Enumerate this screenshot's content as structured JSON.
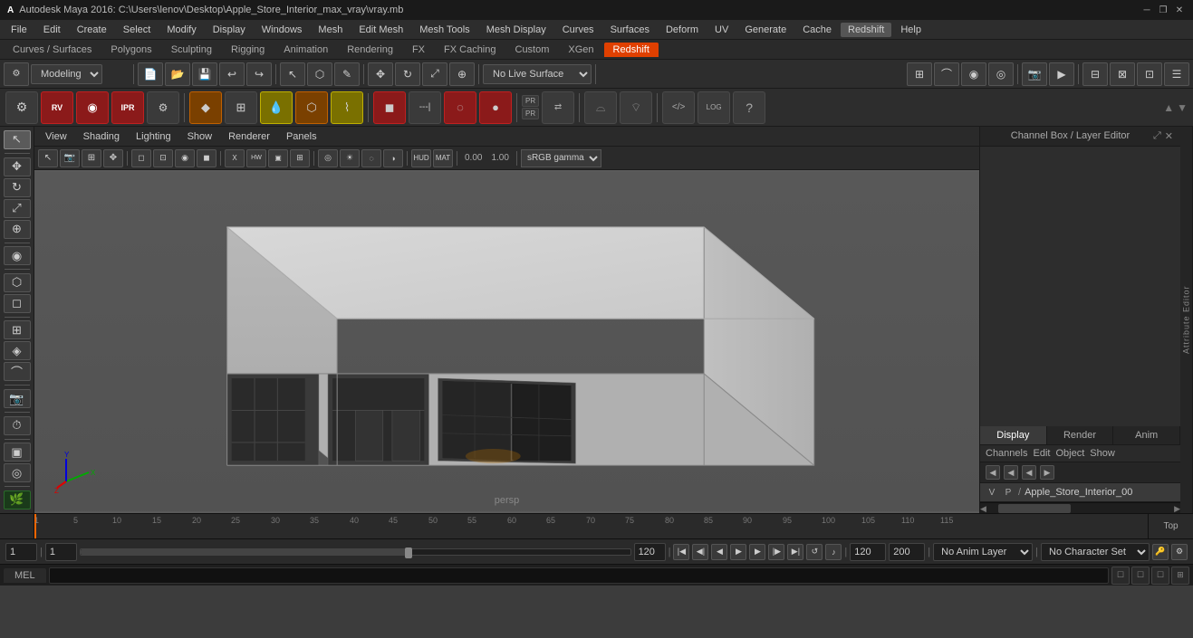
{
  "titlebar": {
    "logo": "A",
    "title": "Autodesk Maya 2016: C:\\Users\\lenov\\Desktop\\Apple_Store_Interior_max_vray\\vray.mb",
    "minimize": "─",
    "restore": "❐",
    "close": "✕"
  },
  "menubar": {
    "items": [
      "File",
      "Edit",
      "Create",
      "Select",
      "Modify",
      "Display",
      "Windows",
      "Mesh",
      "Edit Mesh",
      "Mesh Tools",
      "Mesh Display",
      "Curves",
      "Surfaces",
      "Deform",
      "UV",
      "Generate",
      "Cache",
      "Redshift",
      "Help"
    ]
  },
  "shelf_tabs": {
    "items": [
      "Curves / Surfaces",
      "Polygons",
      "Sculpting",
      "Rigging",
      "Animation",
      "Rendering",
      "FX",
      "FX Caching",
      "Custom",
      "XGen",
      "Redshift"
    ],
    "active": "Redshift"
  },
  "toolbar": {
    "mode_dropdown": "Modeling",
    "live_surface": "No Live Surface"
  },
  "viewport_menubar": {
    "items": [
      "View",
      "Shading",
      "Lighting",
      "Show",
      "Renderer",
      "Panels"
    ]
  },
  "viewport_label": "persp",
  "channel_box": {
    "title": "Channel Box / Layer Editor",
    "tabs": [
      "Display",
      "Render",
      "Anim"
    ],
    "active_tab": "Display",
    "menus": [
      "Channels",
      "Edit",
      "Object",
      "Show"
    ],
    "layer_name": "Apple_Store_Interior_00"
  },
  "timeline": {
    "start": "1",
    "end": "120",
    "current": "1",
    "range_start": "1",
    "range_end": "120",
    "max": "200",
    "ticks": [
      "1",
      "5",
      "10",
      "15",
      "20",
      "25",
      "30",
      "35",
      "40",
      "45",
      "50",
      "55",
      "60",
      "65",
      "70",
      "75",
      "80",
      "85",
      "90",
      "95",
      "100",
      "105",
      "110",
      "115"
    ]
  },
  "bottom_controls": {
    "current_frame": "1",
    "playback_start": "1",
    "range_end": "120",
    "range_max": "200",
    "anim_layer": "No Anim Layer",
    "character": "No Character Set"
  },
  "statusbar": {
    "lang": "MEL"
  },
  "side_labels": {
    "channel_box": "Channel Box / Layer Editor",
    "attribute_editor": "Attribute Editor"
  },
  "icons": {
    "settings": "⚙",
    "transform": "↔",
    "rotate": "↻",
    "scale": "⤢",
    "cursor": "↖",
    "move": "✥",
    "plus": "+",
    "minus": "−",
    "grid": "⊞",
    "sphere": "●",
    "cylinder": "◎",
    "cube": "◻",
    "arrow_up": "▲",
    "arrow_down": "▼",
    "arrow_left": "◀",
    "arrow_right": "▶",
    "play": "▶",
    "stop": "■",
    "rewind": "◀◀",
    "skip_start": "|◀",
    "skip_end": "▶|",
    "prev_frame": "◀",
    "next_frame": "▶",
    "camera": "📷",
    "lasso": "⌒",
    "magnet": "⊕",
    "uv": "UV"
  }
}
